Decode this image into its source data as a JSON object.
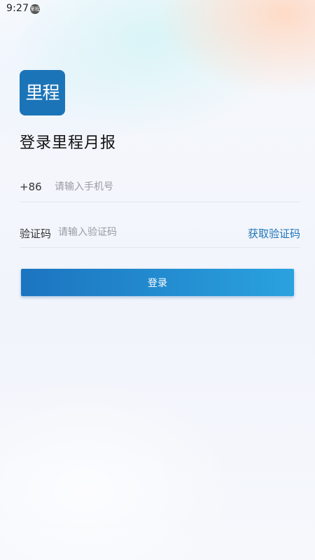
{
  "status_bar": {
    "time": "9:27",
    "app_icon_text": "里程"
  },
  "logo": {
    "text": "里程",
    "color": "#1c74b8"
  },
  "title": "登录里程月报",
  "phone": {
    "country_code": "+86",
    "placeholder": "请输入手机号"
  },
  "code": {
    "label": "验证码",
    "placeholder": "请输入验证码",
    "get_code_label": "获取验证码"
  },
  "login_button": {
    "label": "登录"
  },
  "colors": {
    "accent": "#1c74b8",
    "button_start": "#1c74bf",
    "button_end": "#2aa2df"
  }
}
